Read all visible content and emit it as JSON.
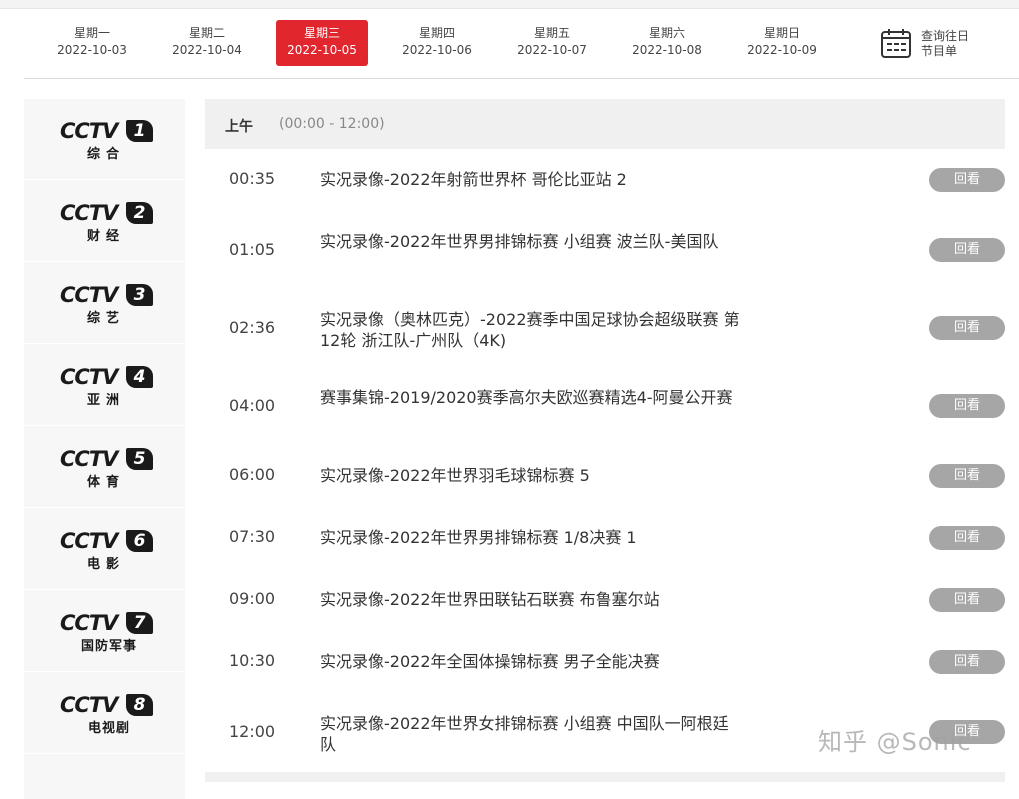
{
  "days": [
    {
      "weekday": "星期一",
      "date": "2022-10-03",
      "active": false
    },
    {
      "weekday": "星期二",
      "date": "2022-10-04",
      "active": false
    },
    {
      "weekday": "星期三",
      "date": "2022-10-05",
      "active": true
    },
    {
      "weekday": "星期四",
      "date": "2022-10-06",
      "active": false
    },
    {
      "weekday": "星期五",
      "date": "2022-10-07",
      "active": false
    },
    {
      "weekday": "星期六",
      "date": "2022-10-08",
      "active": false
    },
    {
      "weekday": "星期日",
      "date": "2022-10-09",
      "active": false
    }
  ],
  "history": {
    "line1": "查询往日",
    "line2": "节目单",
    "icon": "calendar-icon"
  },
  "channels": [
    {
      "brand": "CCTV",
      "number": "1",
      "name": "综合"
    },
    {
      "brand": "CCTV",
      "number": "2",
      "name": "财经"
    },
    {
      "brand": "CCTV",
      "number": "3",
      "name": "综艺"
    },
    {
      "brand": "CCTV",
      "number": "4",
      "name": "亚洲"
    },
    {
      "brand": "CCTV",
      "number": "5",
      "name": "体育"
    },
    {
      "brand": "CCTV",
      "number": "6",
      "name": "电影"
    },
    {
      "brand": "CCTV",
      "number": "7",
      "name": "国防军事"
    },
    {
      "brand": "CCTV",
      "number": "8",
      "name": "电视剧"
    }
  ],
  "period": {
    "label": "上午",
    "range": "(00:00 - 12:00)"
  },
  "programs": [
    {
      "time": "00:35",
      "title": "实况录像-2022年射箭世界杯 哥伦比亚站 2",
      "action": "回看"
    },
    {
      "time": "01:05",
      "title": "实况录像-2022年世界男排锦标赛 小组赛 波兰队-美国队",
      "action": "回看"
    },
    {
      "time": "02:36",
      "title": "实况录像（奥林匹克）-2022赛季中国足球协会超级联赛 第12轮 浙江队-广州队（4K)",
      "action": "回看"
    },
    {
      "time": "04:00",
      "title": "赛事集锦-2019/2020赛季高尔夫欧巡赛精选4-阿曼公开赛",
      "action": "回看"
    },
    {
      "time": "06:00",
      "title": "实况录像-2022年世界羽毛球锦标赛 5",
      "action": "回看"
    },
    {
      "time": "07:30",
      "title": "实况录像-2022年世界男排锦标赛 1/8决赛 1",
      "action": "回看"
    },
    {
      "time": "09:00",
      "title": "实况录像-2022年世界田联钻石联赛 布鲁塞尔站",
      "action": "回看"
    },
    {
      "time": "10:30",
      "title": "实况录像-2022年全国体操锦标赛 男子全能决赛",
      "action": "回看"
    },
    {
      "time": "12:00",
      "title": "实况录像-2022年世界女排锦标赛 小组赛 中国队一阿根廷队",
      "action": "回看"
    }
  ],
  "watermark": "知乎 @Sonic",
  "colors": {
    "active_day": "#e1262e",
    "replay_button": "#a6a6a6",
    "period_bg": "#f0f0f0",
    "channel_bg": "#f7f7f7"
  }
}
